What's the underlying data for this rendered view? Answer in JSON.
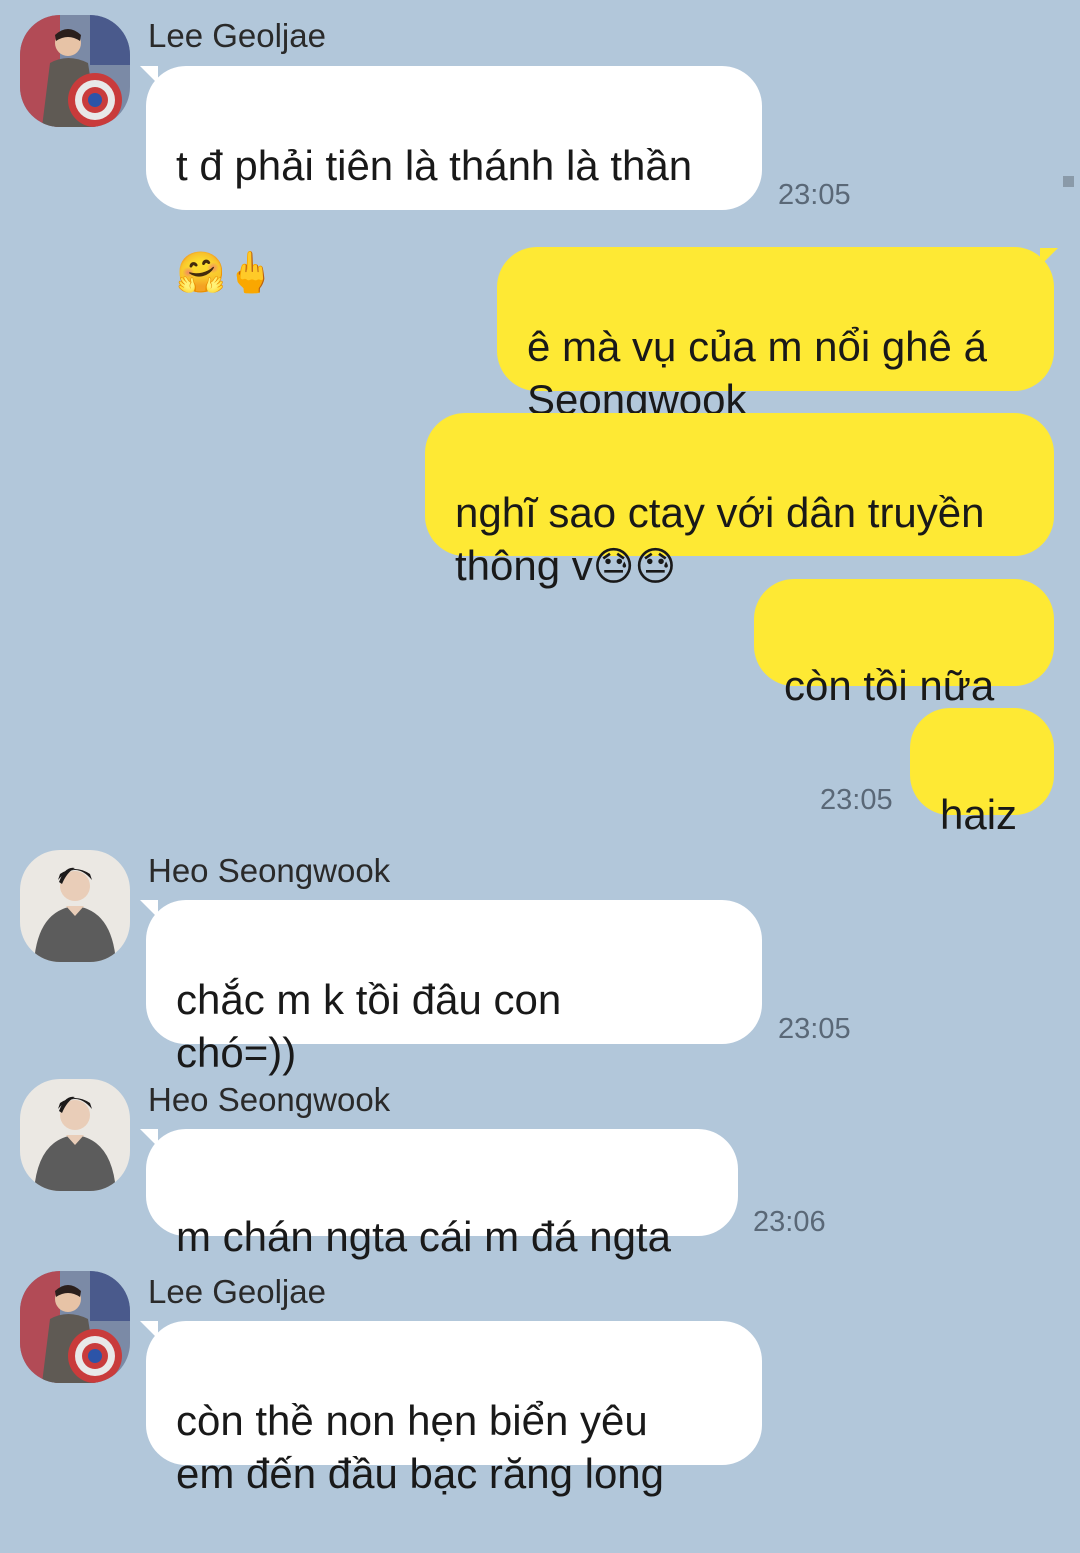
{
  "chat": {
    "messages": [
      {
        "sender": "Lee Geoljae",
        "text": "t đ phải tiên là thánh là thần",
        "emoji": "🤗🖕",
        "time": "23:05"
      },
      {
        "text": "ê mà vụ của m nổi ghê á\nSeongwook"
      },
      {
        "text": "nghĩ sao ctay với dân truyền\nthông v",
        "emoji": "😓😓"
      },
      {
        "text": "còn tồi nữa"
      },
      {
        "text": "haiz",
        "time": "23:05"
      },
      {
        "sender": "Heo Seongwook",
        "text": "chắc m k tồi đâu con\nchó=))",
        "time": "23:05"
      },
      {
        "sender": "Heo Seongwook",
        "text": "m chán ngta cái m đá ngta",
        "time": "23:06"
      },
      {
        "sender": "Lee Geoljae",
        "text": "còn thề non hẹn biển yêu\nem đến đầu bạc răng long"
      }
    ]
  },
  "colors": {
    "background": "#b2c7da",
    "incoming_bubble": "#ffffff",
    "outgoing_bubble": "#fee934",
    "timestamp": "#5a6877"
  },
  "icons": {
    "avatar_lee": "profile-photo-lee-geoljae",
    "avatar_heo": "profile-photo-heo-seongwook"
  }
}
